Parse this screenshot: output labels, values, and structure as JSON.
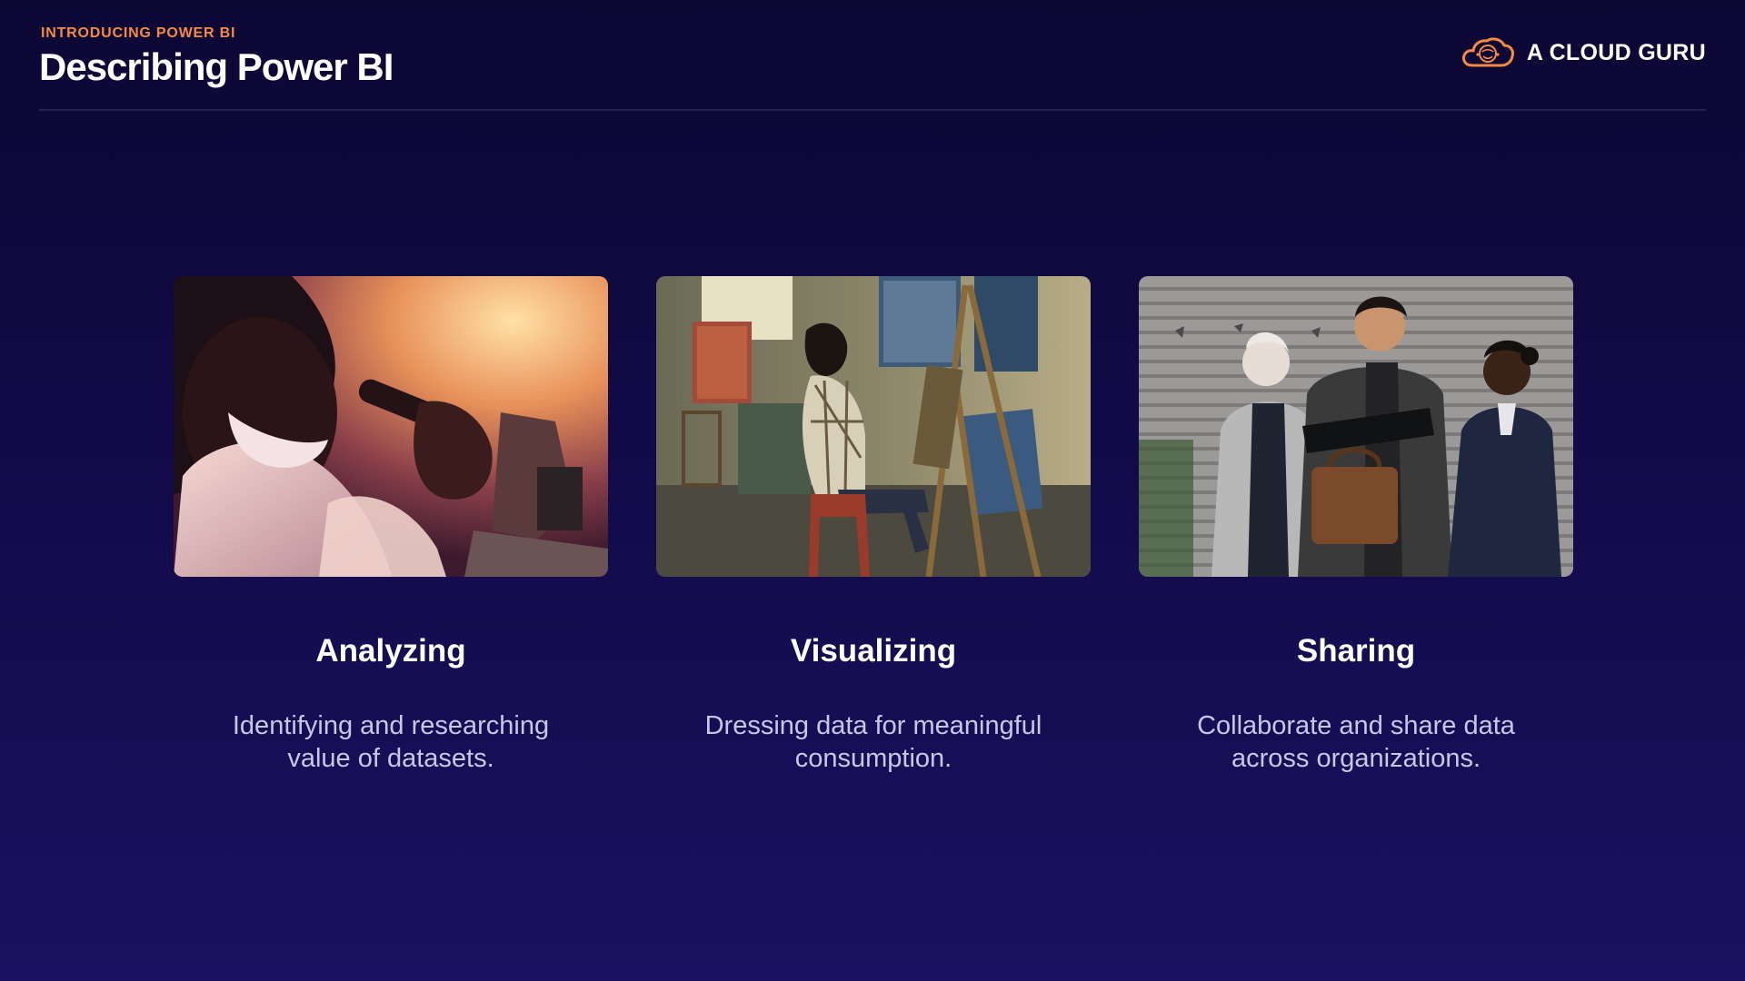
{
  "header": {
    "eyebrow": "INTRODUCING POWER BI",
    "title": "Describing Power BI"
  },
  "brand": {
    "name": "A CLOUD GURU",
    "icon": "cloud-logo-icon",
    "accent": "#f58b43"
  },
  "cards": [
    {
      "title": "Analyzing",
      "description": "Identifying and researching value of datasets.",
      "image": "scientist-microscope-photo"
    },
    {
      "title": "Visualizing",
      "description": "Dressing data for meaningful consumption.",
      "image": "artist-painting-studio-photo"
    },
    {
      "title": "Sharing",
      "description": "Collaborate and share data across organizations.",
      "image": "colleagues-sharing-documents-photo"
    }
  ],
  "colors": {
    "background": "#120a48",
    "text": "#ffffff",
    "muted_text": "#c9c6e6",
    "eyebrow": "#f58b43"
  }
}
